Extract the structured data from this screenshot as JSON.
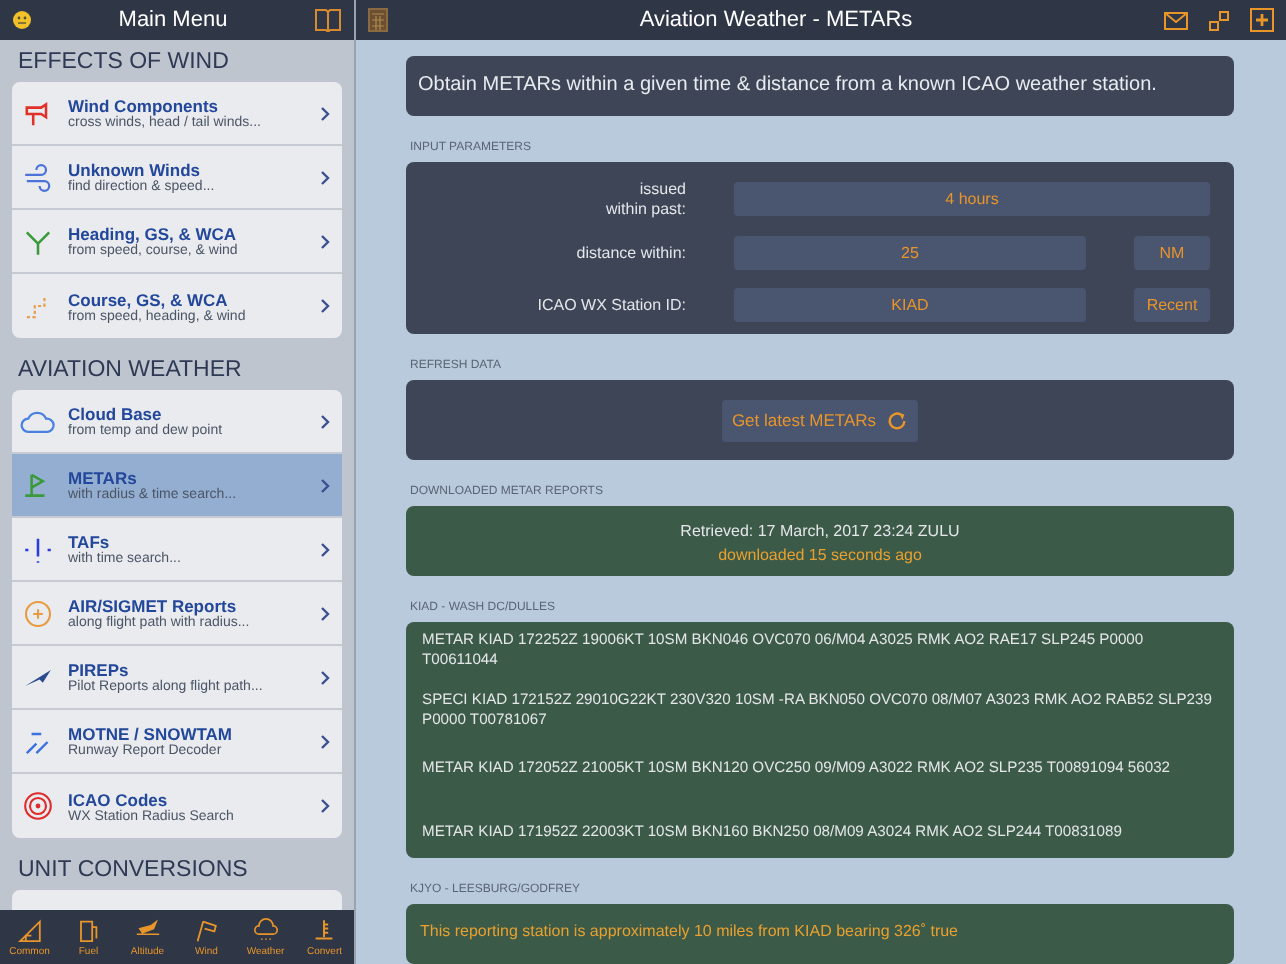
{
  "sidebar": {
    "title": "Main Menu",
    "sections": [
      {
        "heading": "EFFECTS OF WIND",
        "items": [
          {
            "title": "Wind Components",
            "subtitle": "cross winds, head / tail winds...",
            "selected": false
          },
          {
            "title": "Unknown Winds",
            "subtitle": "find direction & speed...",
            "selected": false
          },
          {
            "title": "Heading, GS, & WCA",
            "subtitle": "from speed, course, & wind",
            "selected": false
          },
          {
            "title": "Course, GS, & WCA",
            "subtitle": "from speed, heading, & wind",
            "selected": false
          }
        ]
      },
      {
        "heading": "AVIATION WEATHER",
        "items": [
          {
            "title": "Cloud Base",
            "subtitle": "from temp and dew point",
            "selected": false
          },
          {
            "title": "METARs",
            "subtitle": "with radius & time search...",
            "selected": true
          },
          {
            "title": "TAFs",
            "subtitle": "with time search...",
            "selected": false
          },
          {
            "title": "AIR/SIGMET Reports",
            "subtitle": "along flight path with radius...",
            "selected": false
          },
          {
            "title": "PIREPs",
            "subtitle": "Pilot Reports along flight path...",
            "selected": false
          },
          {
            "title": "MOTNE / SNOWTAM",
            "subtitle": "Runway Report Decoder",
            "selected": false
          },
          {
            "title": "ICAO Codes",
            "subtitle": "WX Station Radius Search",
            "selected": false
          }
        ]
      },
      {
        "heading": "UNIT CONVERSIONS"
      }
    ]
  },
  "tab_bar": [
    {
      "label": "Common"
    },
    {
      "label": "Fuel"
    },
    {
      "label": "Altitude"
    },
    {
      "label": "Wind"
    },
    {
      "label": "Weather"
    },
    {
      "label": "Convert"
    }
  ],
  "main": {
    "title": "Aviation Weather - METARs",
    "description": "Obtain METARs  within a given time & distance from a known ICAO weather station.",
    "input_parameters": {
      "heading": "INPUT PARAMETERS",
      "fields": [
        {
          "label": "issued\nwithin past:",
          "value": "4 hours"
        },
        {
          "label": "distance within:",
          "value": "25",
          "button": "NM"
        },
        {
          "label": "ICAO WX Station ID:",
          "value": "KIAD",
          "button": "Recent"
        }
      ]
    },
    "refresh": {
      "heading": "REFRESH DATA",
      "button": "Get latest METARs"
    },
    "downloaded": {
      "heading": "DOWNLOADED METAR REPORTS",
      "retrieved": "Retrieved: 17 March, 2017 23:24 ZULU",
      "age": "downloaded 15 seconds ago"
    },
    "stations": [
      {
        "heading": "KIAD - WASH DC/DULLES",
        "reports": [
          "METAR KIAD 172252Z 19006KT 10SM BKN046 OVC070 06/M04 A3025 RMK AO2 RAE17 SLP245 P0000 T00611044",
          "SPECI KIAD 172152Z 29010G22KT 230V320 10SM -RA BKN050 OVC070 08/M07 A3023 RMK AO2 RAB52 SLP239 P0000 T00781067",
          "METAR KIAD 172052Z 21005KT 10SM BKN120 OVC250 09/M09 A3022 RMK AO2 SLP235 T00891094 56032",
          "METAR KIAD 171952Z 22003KT 10SM BKN160 BKN250 08/M09 A3024 RMK AO2 SLP244 T00831089"
        ]
      },
      {
        "heading": "KJYO - LEESBURG/GODFREY",
        "note": "This reporting station is approximately 10 miles from KIAD bearing 326˚ true"
      }
    ]
  }
}
